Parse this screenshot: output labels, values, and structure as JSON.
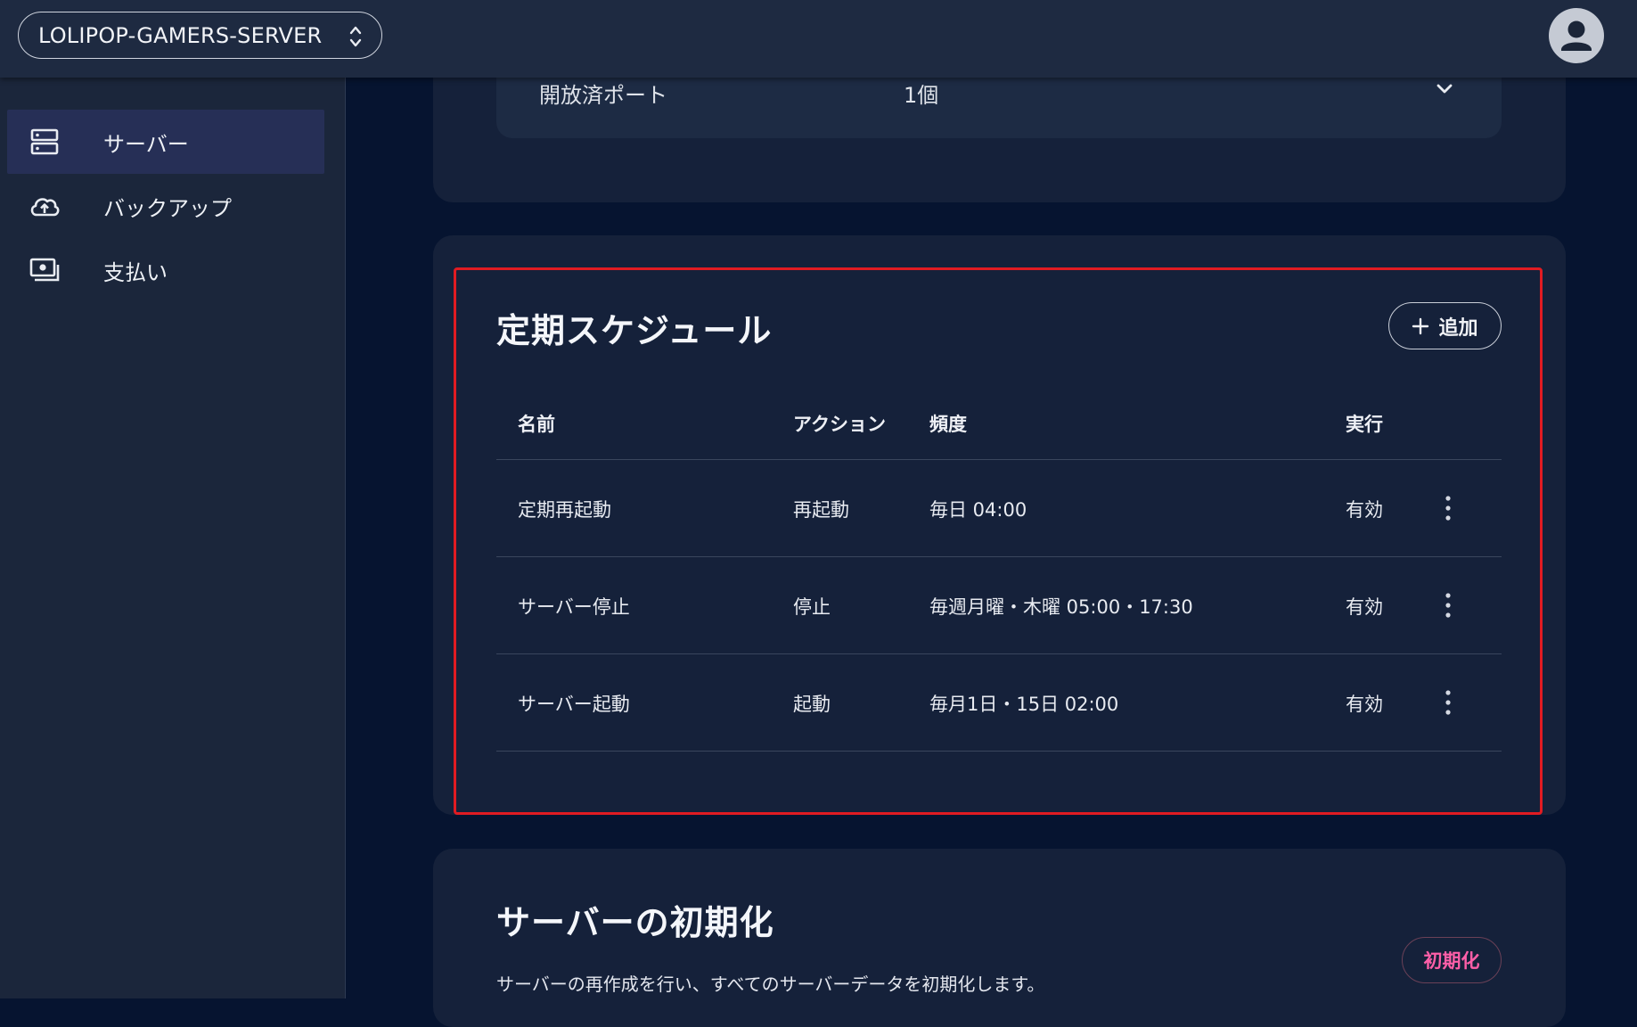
{
  "header": {
    "server_name": "LOLIPOP-GAMERS-SERVER",
    "selector_icon": "unfold-icon",
    "avatar_icon": "user-avatar-icon"
  },
  "sidebar": {
    "items": [
      {
        "label": "サーバー",
        "icon": "server-icon",
        "active": true
      },
      {
        "label": "バックアップ",
        "icon": "cloud-upload-icon",
        "active": false
      },
      {
        "label": "支払い",
        "icon": "payment-icon",
        "active": false
      }
    ]
  },
  "ports": {
    "label": "開放済ポート",
    "value": "1個"
  },
  "schedule": {
    "title": "定期スケジュール",
    "add_label": "追加",
    "headers": {
      "name": "名前",
      "action": "アクション",
      "frequency": "頻度",
      "exec": "実行"
    },
    "rows": [
      {
        "name": "定期再起動",
        "action": "再起動",
        "frequency": "毎日 04:00",
        "exec": "有効"
      },
      {
        "name": "サーバー停止",
        "action": "停止",
        "frequency": "毎週月曜・木曜 05:00・17:30",
        "exec": "有効"
      },
      {
        "name": "サーバー起動",
        "action": "起動",
        "frequency": "毎月1日・15日 02:00",
        "exec": "有効"
      }
    ]
  },
  "init": {
    "title": "サーバーの初期化",
    "description": "サーバーの再作成を行い、すべてのサーバーデータを初期化します。",
    "button_label": "初期化"
  },
  "colors": {
    "highlight": "#e01b22",
    "danger_text": "#ff5fa8"
  }
}
